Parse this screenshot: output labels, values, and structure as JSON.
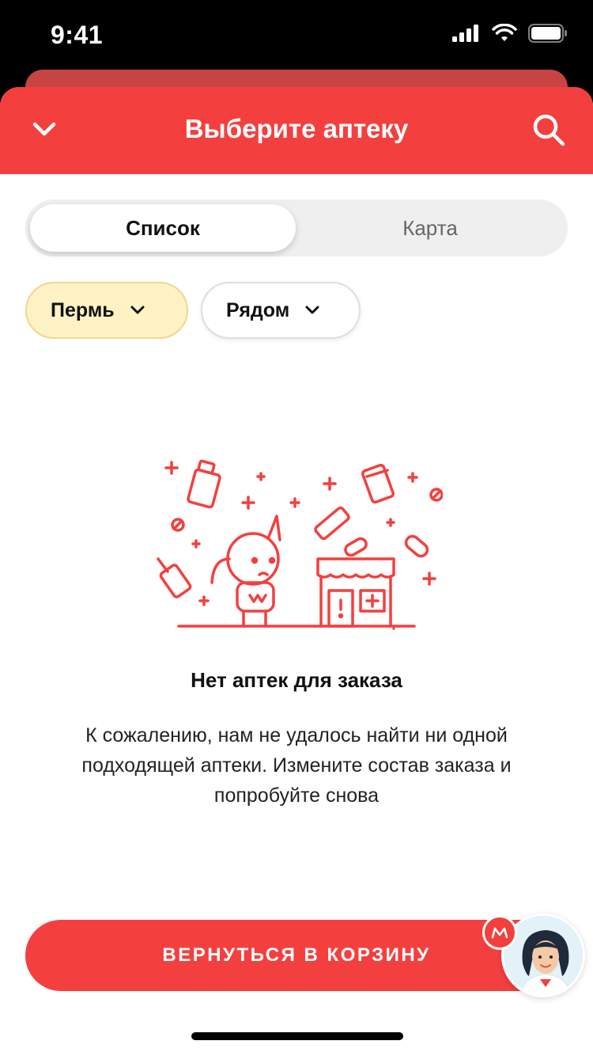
{
  "status_bar": {
    "time": "9:41"
  },
  "header": {
    "title": "Выберите аптеку"
  },
  "segment": {
    "list_label": "Список",
    "map_label": "Карта"
  },
  "filters": {
    "city": "Пермь",
    "distance": "Рядом"
  },
  "empty_state": {
    "title": "Нет аптек для заказа",
    "description": "К сожалению, нам не удалось найти ни одной подходящей аптеки. Измените состав заказа и попробуйте снова"
  },
  "cta": {
    "label": "ВЕРНУТЬСЯ В КОРЗИНУ"
  },
  "colors": {
    "accent": "#f43f3f",
    "chip_active_bg": "#fff2c4",
    "segment_bg": "#efefef"
  },
  "icons": [
    "signal-icon",
    "wifi-icon",
    "battery-icon",
    "chevron-down-icon",
    "search-icon",
    "assistant-avatar",
    "brand-m-icon"
  ]
}
